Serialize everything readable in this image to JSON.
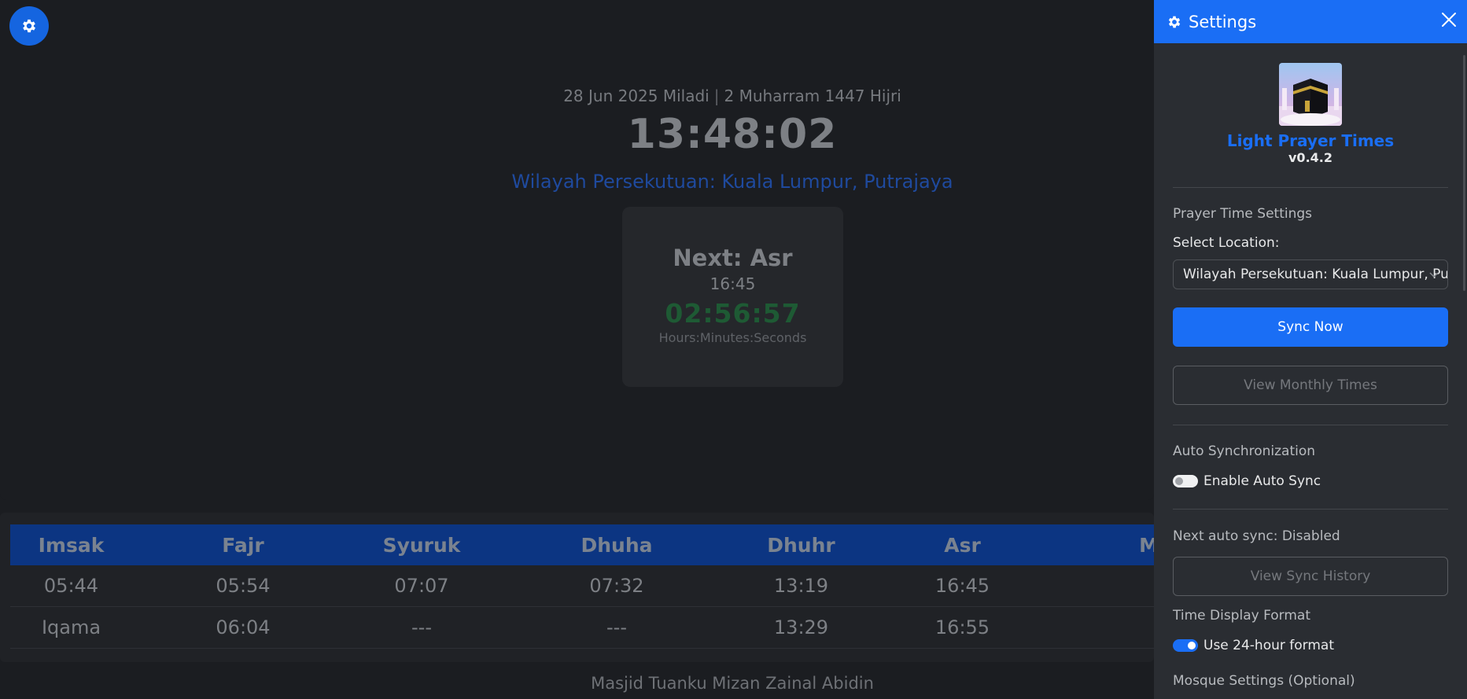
{
  "main": {
    "date_miladi": "28 Jun 2025 Miladi",
    "separator": "|",
    "date_hijri": "2 Muharram 1447 Hijri",
    "clock": "13:48:02",
    "zone": "Wilayah Persekutuan: Kuala Lumpur, Putrajaya",
    "next_title": "Next: Asr",
    "next_time": "16:45",
    "countdown": "02:56:57",
    "countdown_units": "Hours:Minutes:Seconds",
    "table": {
      "headers": [
        "Imsak",
        "Fajr",
        "Syuruk",
        "Dhuha",
        "Dhuhr",
        "Asr",
        "M"
      ],
      "times": [
        "05:44",
        "05:54",
        "07:07",
        "07:32",
        "13:19",
        "16:45",
        ""
      ],
      "iqama": [
        "Iqama",
        "06:04",
        "---",
        "---",
        "13:29",
        "16:55",
        ""
      ]
    },
    "mosque_name": "Masjid Tuanku Mizan Zainal Abidin"
  },
  "settings": {
    "title": "Settings",
    "app_name": "Light Prayer Times",
    "version": "v0.4.2",
    "prayer_section": "Prayer Time Settings",
    "location_label": "Select Location:",
    "location_value": "Wilayah Persekutuan: Kuala Lumpur, Putrajaya",
    "sync_now": "Sync Now",
    "view_monthly": "View Monthly Times",
    "auto_sync_section": "Auto Synchronization",
    "auto_sync_toggle": "Enable Auto Sync",
    "auto_sync_enabled": false,
    "next_auto_sync": "Next auto sync: Disabled",
    "view_sync_history": "View Sync History",
    "time_format_section": "Time Display Format",
    "time_format_toggle": "Use 24-hour format",
    "time_format_24h": true,
    "mosque_section": "Mosque Settings (Optional)"
  },
  "colors": {
    "accent": "#1a6ef5",
    "table_header": "#0c3582",
    "panel_bg": "#2a2d32",
    "page_bg": "#1b1d21"
  },
  "icons": [
    "gear-icon",
    "close-icon",
    "chevron-down-icon",
    "kaaba-logo"
  ]
}
